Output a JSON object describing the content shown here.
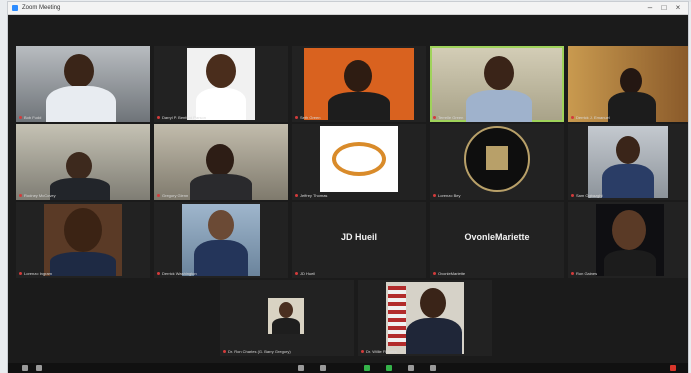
{
  "window": {
    "title": "Zoom Meeting",
    "controls": [
      "–",
      "□",
      "×"
    ]
  },
  "tiles": [
    {
      "caption": "Bob Fudd"
    },
    {
      "caption": "Darryl P. Benford Parson"
    },
    {
      "caption": "Seth Green"
    },
    {
      "caption": "Terrelle Green"
    },
    {
      "caption": "Derrick J. Emanuel"
    },
    {
      "caption": "Rodney McCovey"
    },
    {
      "caption": "Gregory Glenn"
    },
    {
      "caption": "Jeffrey Thomas"
    },
    {
      "caption": "Lorenzo Bey"
    },
    {
      "caption": "Sam Ogbazghi"
    },
    {
      "caption": "Lorenzo Ingram"
    },
    {
      "caption": "Derrick Washington"
    },
    {
      "caption": "JD Hueil",
      "name": "JD Hueil"
    },
    {
      "caption": "OvonleMariette",
      "name": "OvonleMariette"
    },
    {
      "caption": "Ron Gaines"
    },
    {
      "caption": "Dr. Ron Charles (G. Barry Gregory)"
    },
    {
      "caption": "Dr. Willie Flowers"
    }
  ],
  "colors": {
    "background": "#1b1b1b",
    "active_speaker": "#9fd35a",
    "muted_mic": "#d23b3b"
  },
  "icons": [
    "unmute-icon",
    "video-icon",
    "security-icon",
    "participants-icon",
    "chat-icon",
    "share-screen-icon",
    "record-icon",
    "reactions-icon",
    "end-meeting-icon"
  ]
}
